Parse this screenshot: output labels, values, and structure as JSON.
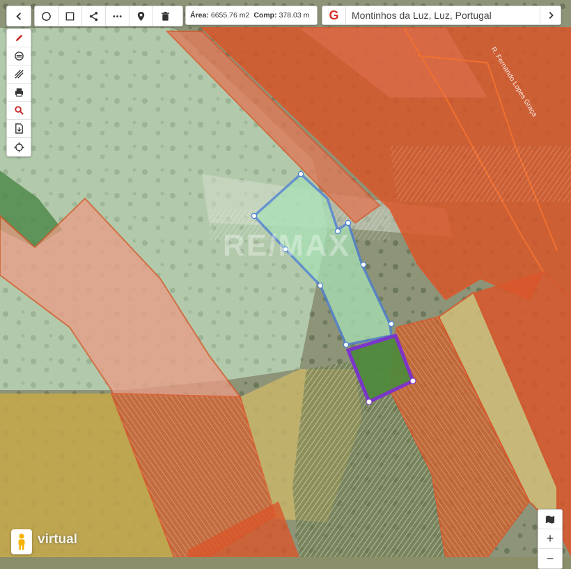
{
  "toolbar": {
    "back_icon": "chevron-left-icon",
    "tools": [
      {
        "name": "circle-tool",
        "icon": "circle-icon"
      },
      {
        "name": "rectangle-tool",
        "icon": "square-icon"
      },
      {
        "name": "share-tool",
        "icon": "share-icon"
      },
      {
        "name": "measure-line-tool",
        "icon": "dotted-line-icon"
      },
      {
        "name": "marker-tool",
        "icon": "map-pin-icon"
      },
      {
        "name": "delete-tool",
        "icon": "trash-icon"
      }
    ]
  },
  "measure": {
    "area_label": "Área:",
    "area_value": "6655.76 m2",
    "length_label": "Comp:",
    "length_value": "378.03 m"
  },
  "search": {
    "provider_label": "G",
    "value": "Montinhos da Luz, Luz, Portugal",
    "next_icon": "chevron-right-icon"
  },
  "sidebar": {
    "items": [
      {
        "name": "draw-tool",
        "icon": "pencil-icon"
      },
      {
        "name": "layers-tool",
        "icon": "layers-circle-icon"
      },
      {
        "name": "hatch-tool",
        "icon": "hatch-icon"
      },
      {
        "name": "print-tool",
        "icon": "printer-icon"
      },
      {
        "name": "search-tool",
        "icon": "search-icon"
      },
      {
        "name": "export-tool",
        "icon": "file-icon"
      },
      {
        "name": "locate-tool",
        "icon": "crosshair-icon"
      }
    ]
  },
  "map": {
    "street_label": "R. Fernando Lopes Graça",
    "watermark": "RE/MAX",
    "colors": {
      "orange_zone": "#d9562a",
      "peach_zone": "#e8987a",
      "green_zone": "#a9cfa6",
      "yellow_zone": "#cdb04a",
      "selection_outline": "#4a7fd6",
      "selection_fill": "#a8e0b5",
      "plot_outline": "#7a2fd0",
      "plot_fill": "#4e8a3c"
    }
  },
  "zoom": {
    "plus": "+",
    "minus": "−",
    "map_type_icon": "map-icon"
  },
  "streetview": {
    "label": "virtual",
    "icon": "pegman-icon"
  }
}
